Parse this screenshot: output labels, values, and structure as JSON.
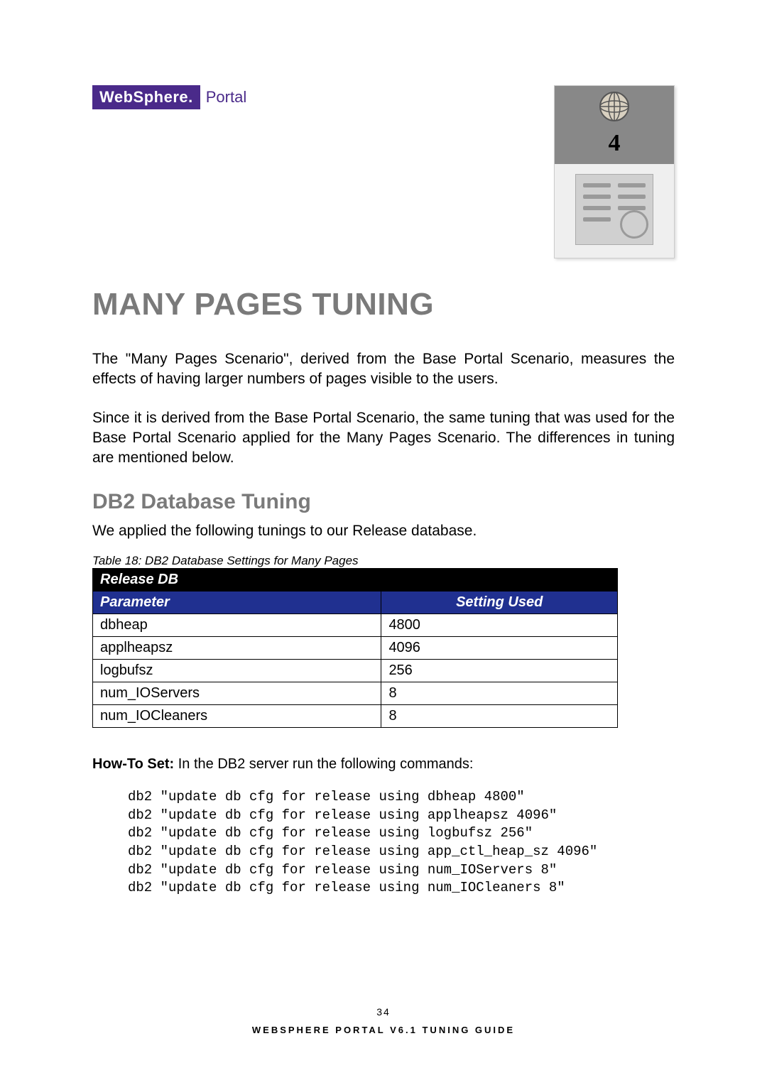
{
  "brand": {
    "box": "WebSphere.",
    "suffix": "Portal"
  },
  "chapter": {
    "number": "4",
    "title": "MANY PAGES TUNING"
  },
  "intro": {
    "p1": "The \"Many Pages Scenario\", derived from the Base Portal Scenario, measures the effects of having larger numbers of pages visible to the users.",
    "p2": "Since it is derived from the Base Portal Scenario, the same tuning that was used for the Base Portal Scenario applied for the Many Pages Scenario.  The differences in tuning are mentioned below."
  },
  "section": {
    "heading": "DB2 Database Tuning",
    "lead": "We applied the following tunings to our Release database.",
    "table_caption": "Table 18: DB2 Database Settings for Many Pages",
    "table_title": "Release DB",
    "col_param": "Parameter",
    "col_setting": "Setting Used",
    "rows": [
      {
        "param": "dbheap",
        "value": "4800"
      },
      {
        "param": "applheapsz",
        "value": "4096"
      },
      {
        "param": "logbufsz",
        "value": "256"
      },
      {
        "param": "num_IOServers",
        "value": "8"
      },
      {
        "param": "num_IOCleaners",
        "value": "8"
      }
    ]
  },
  "howto": {
    "label": "How-To Set:",
    "text": " In the DB2 server run the following commands:"
  },
  "commands": "db2 \"update db cfg for release using dbheap 4800\"\ndb2 \"update db cfg for release using applheapsz 4096\"\ndb2 \"update db cfg for release using logbufsz 256\"\ndb2 \"update db cfg for release using app_ctl_heap_sz 4096\"\ndb2 \"update db cfg for release using num_IOServers 8\"\ndb2 \"update db cfg for release using num_IOCleaners 8\"",
  "footer": {
    "page": "34",
    "title": "WEBSPHERE PORTAL V6.1 TUNING GUIDE"
  }
}
